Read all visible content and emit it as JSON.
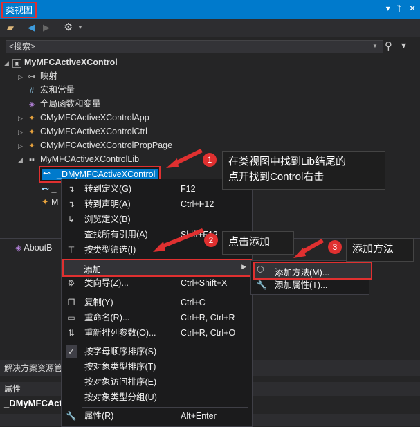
{
  "window": {
    "title": "类视图",
    "pin_icon": "▾",
    "pin2_icon": "ᛘ",
    "close_icon": "✕"
  },
  "search": {
    "placeholder": "<搜索>"
  },
  "tree": {
    "root": "MyMFCActiveXControl",
    "items": [
      {
        "label": "映射"
      },
      {
        "label": "宏和常量"
      },
      {
        "label": "全局函数和变量"
      },
      {
        "label": "CMyMFCActiveXControlApp"
      },
      {
        "label": "CMyMFCActiveXControlCtrl"
      },
      {
        "label": "CMyMFCActiveXControlPropPage"
      },
      {
        "label": "MyMFCActiveXControlLib"
      }
    ],
    "selected": "_DMyMFCActiveXControl",
    "child2_partial": "_",
    "child3_partial": "M",
    "about_partial": "AboutB"
  },
  "context_menu": {
    "items": [
      {
        "label": "转到定义(G)",
        "shortcut": "F12"
      },
      {
        "label": "转到声明(A)",
        "shortcut": "Ctrl+F12"
      },
      {
        "label": "浏览定义(B)",
        "shortcut": ""
      },
      {
        "label": "查找所有引用(A)",
        "shortcut": "Shift+F12"
      },
      {
        "label": "按类型筛选(I)",
        "shortcut": ""
      },
      {
        "label": "添加",
        "shortcut": ""
      },
      {
        "label": "类向导(Z)...",
        "shortcut": "Ctrl+Shift+X"
      },
      {
        "label": "复制(Y)",
        "shortcut": "Ctrl+C"
      },
      {
        "label": "重命名(R)...",
        "shortcut": "Ctrl+R, Ctrl+R"
      },
      {
        "label": "重新排列参数(O)...",
        "shortcut": "Ctrl+R, Ctrl+O"
      },
      {
        "label": "按字母顺序排序(S)",
        "shortcut": ""
      },
      {
        "label": "按对象类型排序(T)",
        "shortcut": ""
      },
      {
        "label": "按对象访问排序(E)",
        "shortcut": ""
      },
      {
        "label": "按对象类型分组(U)",
        "shortcut": ""
      },
      {
        "label": "属性(R)",
        "shortcut": "Alt+Enter"
      }
    ]
  },
  "submenu": {
    "items": [
      {
        "label": "添加方法(M)..."
      },
      {
        "label": "添加属性(T)..."
      }
    ]
  },
  "callouts": [
    {
      "num": "1",
      "line1": "在类视图中找到Lib结尾的",
      "line2": "点开找到Control右击"
    },
    {
      "num": "2",
      "text": "点击添加"
    },
    {
      "num": "3",
      "text": "添加方法"
    }
  ],
  "panels": {
    "solution_tab": "解决方案资源管",
    "properties_title": "属性",
    "properties_object": "_DMyMFCActi"
  },
  "colors": {
    "accent": "#007acc",
    "highlight_border": "#e03030"
  }
}
